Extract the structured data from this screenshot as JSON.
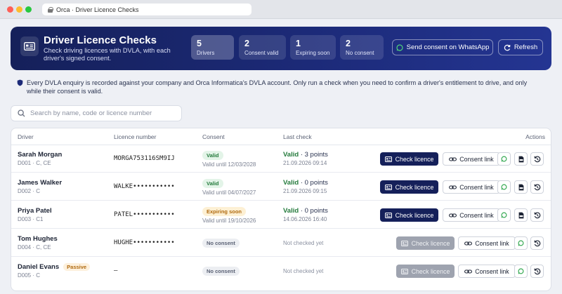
{
  "browser": {
    "tab_title": "Orca · Driver Licence Checks"
  },
  "header": {
    "title": "Driver Licence Checks",
    "subtitle": "Check driving licences with DVLA, with each driver's signed consent.",
    "stats": [
      {
        "value": "5",
        "label": "Drivers"
      },
      {
        "value": "2",
        "label": "Consent valid"
      },
      {
        "value": "1",
        "label": "Expiring soon"
      },
      {
        "value": "2",
        "label": "No consent"
      }
    ],
    "whatsapp_label": "Send consent on WhatsApp",
    "refresh_label": "Refresh"
  },
  "notice": "Every DVLA enquiry is recorded against your company and Orca Informatica's DVLA account. Only run a check when you need to confirm a driver's entitlement to drive, and only while their consent is valid.",
  "search": {
    "placeholder": "Search by name, code or licence number"
  },
  "table": {
    "columns": {
      "driver": "Driver",
      "licence": "Licence number",
      "consent": "Consent",
      "last_check": "Last check",
      "actions": "Actions"
    },
    "rows": [
      {
        "name": "Sarah Morgan",
        "code": "D001 · C, CE",
        "licence": "MORGA753116SM9IJ",
        "consent_badge": "Valid",
        "consent_until": "Valid until 12/03/2028",
        "check_status": "Valid",
        "check_points": " · 3 points",
        "check_date": "21.09.2026 09:14"
      },
      {
        "name": "James Walker",
        "code": "D002 · C",
        "licence": "WALKE•••••••••••",
        "consent_badge": "Valid",
        "consent_until": "Valid until 04/07/2027",
        "check_status": "Valid",
        "check_points": " · 0 points",
        "check_date": "21.09.2026 09:15"
      },
      {
        "name": "Priya Patel",
        "code": "D003 · C1",
        "licence": "PATEL•••••••••••",
        "consent_badge": "Expiring soon",
        "consent_until": "Valid until 19/10/2026",
        "check_status": "Valid",
        "check_points": " · 0 points",
        "check_date": "14.06.2026 16:40"
      },
      {
        "name": "Tom Hughes",
        "code": "D004 · C, CE",
        "licence": "HUGHE•••••••••••",
        "consent_badge": "No consent",
        "check_none": "Not checked yet"
      },
      {
        "name": "Daniel Evans",
        "passive": "Passive",
        "code": "D005 · C",
        "licence": "—",
        "consent_badge": "No consent",
        "check_none": "Not checked yet"
      }
    ],
    "check_label": "Check licence",
    "consent_link_label": "Consent link"
  },
  "colors": {
    "navy": "#15205a",
    "valid_green": "#237a3b",
    "warning_amber": "#b06a10",
    "whatsapp": "#25a244"
  }
}
